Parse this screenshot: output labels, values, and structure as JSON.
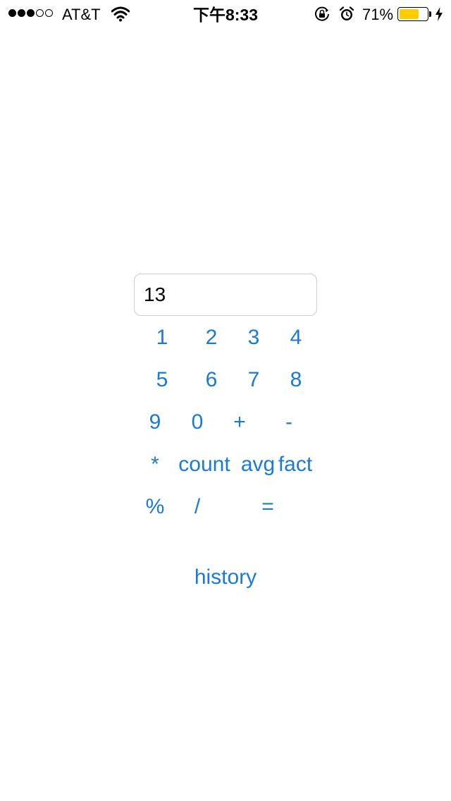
{
  "status_bar": {
    "signal_bars_filled": 3,
    "signal_bars_total": 5,
    "carrier": "AT&T",
    "time": "下午8:33",
    "battery_percent": "71%",
    "battery_level": 0.71,
    "battery_color": "#ffcc00",
    "icons": [
      "wifi-icon",
      "orientation-lock-icon",
      "alarm-icon",
      "battery-icon",
      "charging-bolt-icon"
    ]
  },
  "calculator": {
    "display_value": "13",
    "accent_color": "#1a7ad6",
    "keys": {
      "k1": "1",
      "k2": "2",
      "k3": "3",
      "k4": "4",
      "k5": "5",
      "k6": "6",
      "k7": "7",
      "k8": "8",
      "k9": "9",
      "k0": "0",
      "plus": "+",
      "minus": "-",
      "multiply": "*",
      "count": "count",
      "avg": "avg",
      "fact": "fact",
      "percent": "%",
      "divide": "/",
      "equals": "="
    },
    "history_label": "history"
  }
}
